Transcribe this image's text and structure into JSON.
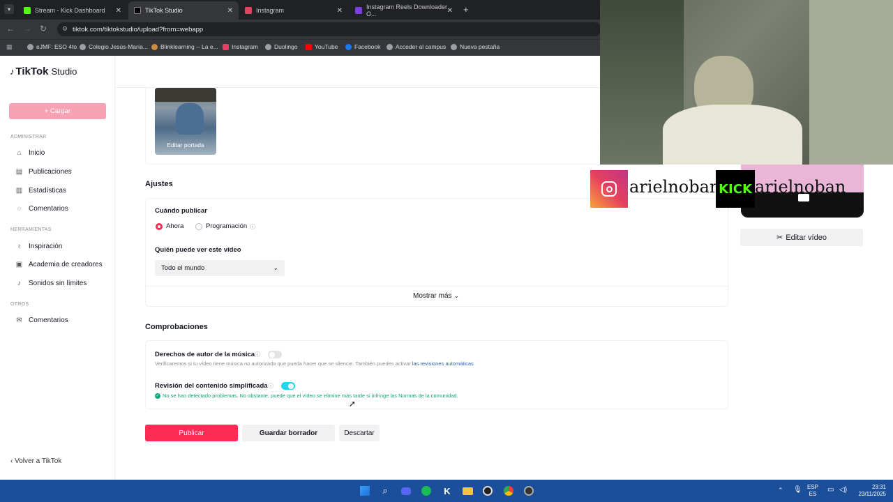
{
  "browser": {
    "tabs": [
      {
        "label": "Stream - Kick Dashboard",
        "color": "#53fc18"
      },
      {
        "label": "TikTok Studio",
        "color": "#000000"
      },
      {
        "label": "Instagram",
        "color": "#e4405f"
      },
      {
        "label": "Instagram Reels Downloader O...",
        "color": "#7b3fe4"
      }
    ],
    "url": "tiktok.com/tiktokstudio/upload?from=webapp",
    "bookmarks": [
      "eJMF: ESO 4to",
      "Colegio Jesús-María...",
      "Blinklearning -- La e...",
      "Instagram",
      "Duolingo",
      "YouTube",
      "Facebook",
      "Acceder al campus",
      "Nueva pestaña"
    ]
  },
  "sidebar": {
    "brand": "TikTok",
    "brand_suffix": "Studio",
    "upload_label": "+ Cargar",
    "section_admin": "ADMINISTRAR",
    "admin_items": [
      "Inicio",
      "Publicaciones",
      "Estadísticas",
      "Comentarios"
    ],
    "section_tools": "HERRAMIENTAS",
    "tool_items": [
      "Inspiración",
      "Academia de creadores",
      "Sonidos sin límites"
    ],
    "section_other": "OTROS",
    "other_items": [
      "Comentarios"
    ],
    "back_label": "Volver a TikTok"
  },
  "main": {
    "cover_label": "Editar portada",
    "settings_title": "Ajustes",
    "when_label": "Cuándo publicar",
    "when_now": "Ahora",
    "when_schedule": "Programación",
    "who_label": "Quién puede ver este vídeo",
    "who_value": "Todo el mundo",
    "show_more": "Mostrar más",
    "checks_title": "Comprobaciones",
    "copyright_label": "Derechos de autor de la música",
    "copyright_desc": "Verificaremos si tu vídeo tiene música no autorizada que pueda hacer que se silencie. También puedes activar",
    "copyright_link": "las revisiones automáticas",
    "content_label": "Revisión del contenido simplificada",
    "content_desc": "No se han detectado problemas. No obstante, puede que el vídeo se elimine más tarde si infringe las Normas de la comunidad.",
    "publish": "Publicar",
    "save_draft": "Guardar borrador",
    "discard": "Descartar"
  },
  "overlay": {
    "insta_handle": "arielnoban",
    "kick_logo": "KICK",
    "kick_handle": "arielnoban",
    "edit_video": "Editar vídeo"
  },
  "taskbar": {
    "lang_top": "ESP",
    "lang_bottom": "ES",
    "time": "23:31",
    "date": "23/11/2025"
  },
  "colors": {
    "accent": "#fe2c55",
    "toggle_on": "#20d5ec",
    "success": "#0fa67b",
    "taskbar": "#1b4f9a"
  }
}
